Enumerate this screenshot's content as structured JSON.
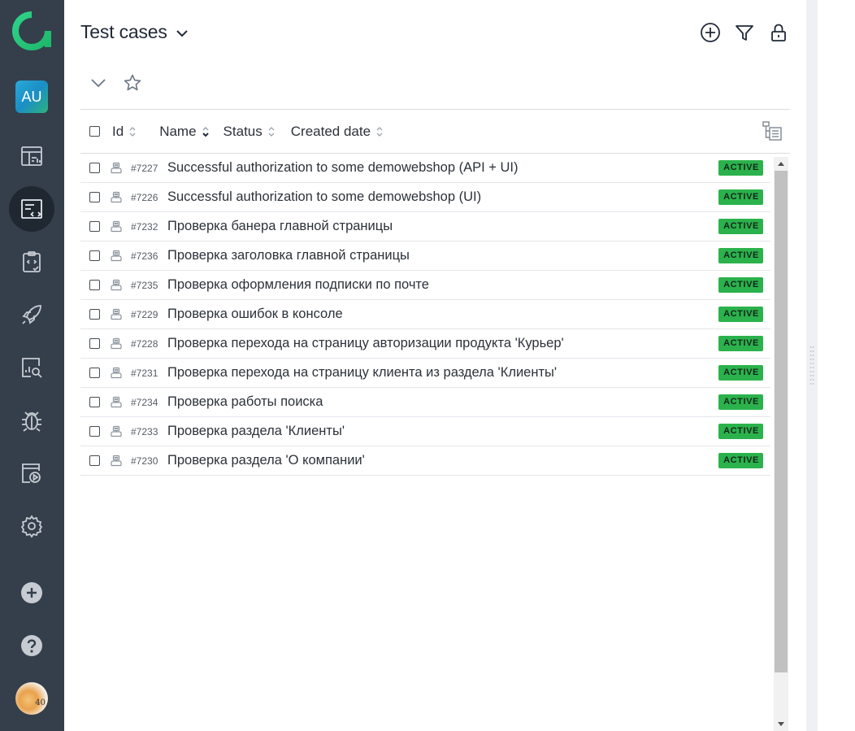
{
  "sidebar": {
    "project_initials": "AU",
    "items": [
      {
        "name": "dashboards",
        "icon": "dashboard-icon"
      },
      {
        "name": "test-cases",
        "icon": "test-cases-icon",
        "active": true
      },
      {
        "name": "test-plans",
        "icon": "test-plan-icon"
      },
      {
        "name": "launches",
        "icon": "rocket-icon"
      },
      {
        "name": "analytics",
        "icon": "analytics-icon"
      },
      {
        "name": "defects",
        "icon": "bug-icon"
      },
      {
        "name": "jobs",
        "icon": "jobs-icon"
      },
      {
        "name": "settings",
        "icon": "gear-icon"
      }
    ],
    "bottom_icons": [
      "plus-circle-icon",
      "help-icon"
    ],
    "avatar_label": "40"
  },
  "header": {
    "title": "Test cases",
    "actions": [
      "add-icon",
      "filter-icon",
      "lock-icon"
    ]
  },
  "table": {
    "columns": {
      "id": "Id",
      "name": "Name",
      "status": "Status",
      "created": "Created date"
    },
    "rows": [
      {
        "id": "#7227",
        "name": "Successful authorization to some demowebshop (API + UI)",
        "status": "ACTIVE"
      },
      {
        "id": "#7226",
        "name": "Successful authorization to some demowebshop (UI)",
        "status": "ACTIVE"
      },
      {
        "id": "#7232",
        "name": "Проверка банера главной страницы",
        "status": "ACTIVE"
      },
      {
        "id": "#7236",
        "name": "Проверка заголовка главной страницы",
        "status": "ACTIVE"
      },
      {
        "id": "#7235",
        "name": "Проверка оформления подписки по почте",
        "status": "ACTIVE"
      },
      {
        "id": "#7229",
        "name": "Проверка ошибок в консоле",
        "status": "ACTIVE"
      },
      {
        "id": "#7228",
        "name": "Проверка перехода на страницу авторизации продукта 'Курьер'",
        "status": "ACTIVE"
      },
      {
        "id": "#7231",
        "name": "Проверка перехода на страницу клиента из раздела 'Клиенты'",
        "status": "ACTIVE"
      },
      {
        "id": "#7234",
        "name": "Проверка работы поиска",
        "status": "ACTIVE"
      },
      {
        "id": "#7233",
        "name": "Проверка раздела 'Клиенты'",
        "status": "ACTIVE"
      },
      {
        "id": "#7230",
        "name": "Проверка раздела 'О компании'",
        "status": "ACTIVE"
      }
    ]
  },
  "colors": {
    "sidebar_bg": "#343f4b",
    "active_bg": "#1f2731",
    "badge_green": "#2bb24c",
    "logo_green": "#3ddc84"
  }
}
